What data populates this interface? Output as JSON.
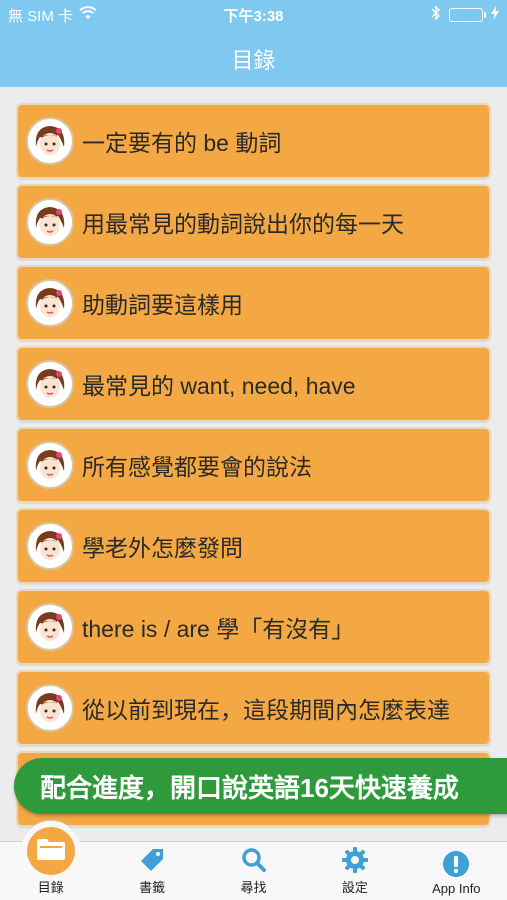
{
  "status_bar": {
    "carrier": "無 SIM 卡",
    "time": "下午3:38"
  },
  "nav": {
    "title": "目錄"
  },
  "rows": [
    {
      "label": "一定要有的 be 動詞"
    },
    {
      "label": "用最常見的動詞說出你的每一天"
    },
    {
      "label": "助動詞要這樣用"
    },
    {
      "label": "最常見的 want, need, have"
    },
    {
      "label": "所有感覺都要會的說法"
    },
    {
      "label": "學老外怎麼發問"
    },
    {
      "label": "there is / are 學「有沒有」"
    },
    {
      "label": "從以前到現在，這段期間內怎麼表達"
    }
  ],
  "promo": {
    "text": "配合進度，開口說英語16天快速養成"
  },
  "tabs": [
    {
      "label": "目錄",
      "icon": "folder-icon"
    },
    {
      "label": "書籤",
      "icon": "tag-icon"
    },
    {
      "label": "尋找",
      "icon": "search-icon"
    },
    {
      "label": "設定",
      "icon": "gear-icon"
    },
    {
      "label": "App Info",
      "icon": "info-icon"
    }
  ],
  "colors": {
    "nav": "#7fc8f0",
    "row": "#f3a844",
    "promo": "#2f9a3c",
    "tab_icon": "#3fa0d8"
  }
}
